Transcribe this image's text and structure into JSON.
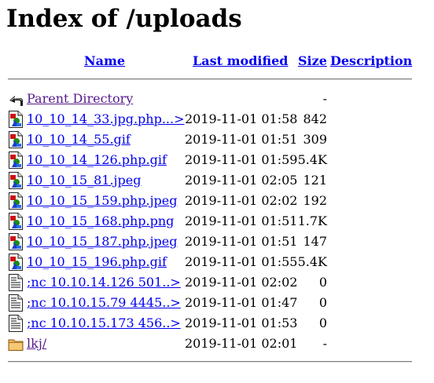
{
  "title": "Index of /uploads",
  "columns": {
    "name": "Name",
    "last_modified": "Last modified",
    "size": "Size",
    "description": "Description"
  },
  "rows": [
    {
      "icon": "back-icon",
      "name": "Parent Directory",
      "modified": "",
      "size": "-",
      "visited": true
    },
    {
      "icon": "image-file-icon",
      "name": "10_10_14_33.jpg.php...>",
      "modified": "2019-11-01 01:58",
      "size": "842"
    },
    {
      "icon": "image-file-icon",
      "name": "10_10_14_55.gif",
      "modified": "2019-11-01 01:51",
      "size": "309"
    },
    {
      "icon": "image-file-icon",
      "name": "10_10_14_126.php.gif",
      "modified": "2019-11-01 01:59",
      "size": "5.4K"
    },
    {
      "icon": "image-file-icon",
      "name": "10_10_15_81.jpeg",
      "modified": "2019-11-01 02:05",
      "size": "121"
    },
    {
      "icon": "image-file-icon",
      "name": "10_10_15_159.php.jpeg",
      "modified": "2019-11-01 02:02",
      "size": "192"
    },
    {
      "icon": "image-file-icon",
      "name": "10_10_15_168.php.png",
      "modified": "2019-11-01 01:51",
      "size": "1.7K"
    },
    {
      "icon": "image-file-icon",
      "name": "10_10_15_187.php.jpeg",
      "modified": "2019-11-01 01:51",
      "size": "147"
    },
    {
      "icon": "image-file-icon",
      "name": "10_10_15_196.php.gif",
      "modified": "2019-11-01 01:55",
      "size": "5.4K"
    },
    {
      "icon": "text-file-icon",
      "name": ";nc 10.10.14.126 501..>",
      "modified": "2019-11-01 02:02",
      "size": "0"
    },
    {
      "icon": "text-file-icon",
      "name": ";nc 10.10.15.79 4445..>",
      "modified": "2019-11-01 01:47",
      "size": "0"
    },
    {
      "icon": "text-file-icon",
      "name": ";nc 10.10.15.173 456..>",
      "modified": "2019-11-01 01:53",
      "size": "0"
    },
    {
      "icon": "folder-icon",
      "name": "lkj/",
      "modified": "2019-11-01 02:01",
      "size": "-",
      "visited": true
    }
  ],
  "colors": {
    "link": "#0000ee",
    "visited_link": "#551a8b"
  }
}
